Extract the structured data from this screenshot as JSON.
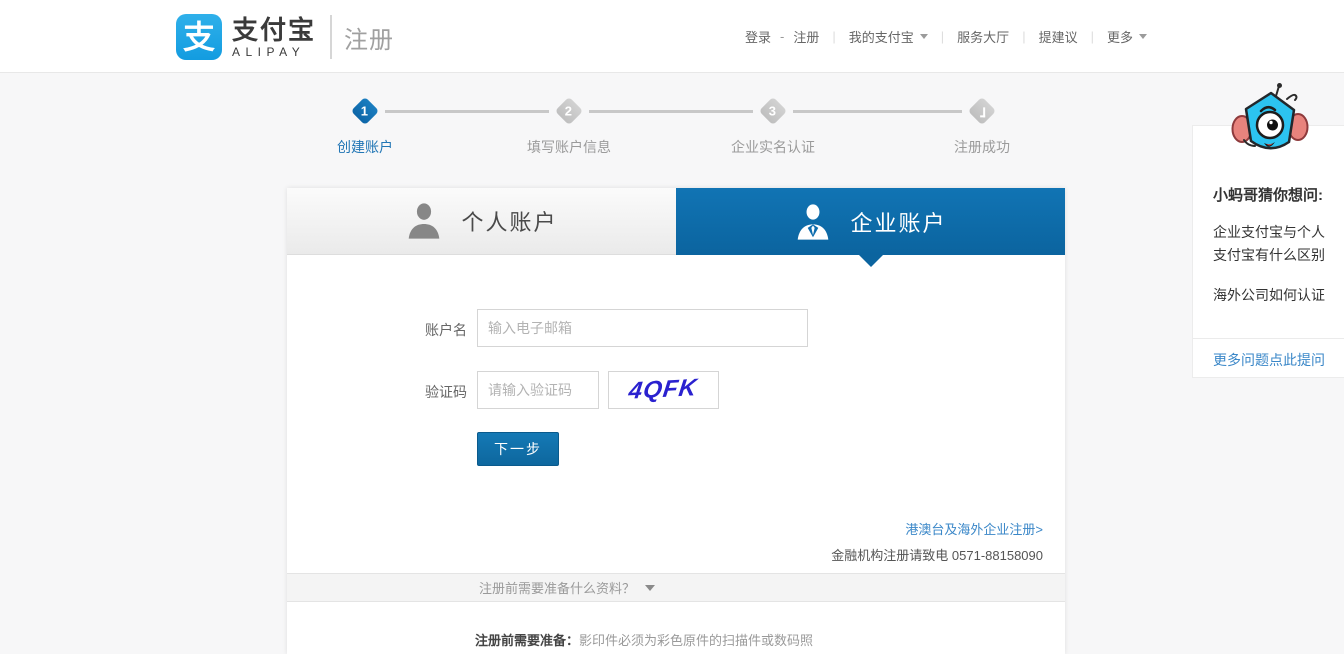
{
  "brand": {
    "logo_glyph": "支",
    "name_cn": "支付宝",
    "name_en": "ALIPAY",
    "page_label": "注册"
  },
  "nav": {
    "login": "登录",
    "register": "注册",
    "my_alipay": "我的支付宝",
    "service_hall": "服务大厅",
    "feedback": "提建议",
    "more": "更多",
    "sep_dash": "-",
    "sep_bar": "|"
  },
  "steps": {
    "items": [
      {
        "number": "1",
        "label": "创建账户",
        "state": "active"
      },
      {
        "number": "2",
        "label": "填写账户信息",
        "state": "pending"
      },
      {
        "number": "3",
        "label": "企业实名认证",
        "state": "pending"
      },
      {
        "number": "",
        "label": "注册成功",
        "state": "pending-check"
      }
    ]
  },
  "tabs": {
    "personal": "个人账户",
    "enterprise": "企业账户",
    "active_tab": "企业账户"
  },
  "form": {
    "account_label": "账户名",
    "account_placeholder": "输入电子邮箱",
    "account_value": "",
    "captcha_label": "验证码",
    "captcha_placeholder": "请输入验证码",
    "captcha_input_value": "",
    "captcha_value": "4QFK",
    "submit_label": "下一步"
  },
  "links": {
    "overseas": "港澳台及海外企业注册>",
    "finance": "金融机构注册请致电 0571-88158090"
  },
  "prepare": {
    "toggle_label": "注册前需要准备什么资料？",
    "note_prefix": "注册前需要准备：",
    "note_text": "影印件必须为彩色原件的扫描件或数码照"
  },
  "assistant": {
    "title": "小蚂哥猜你想问:",
    "questions": [
      "企业支付宝与个人支付宝有什么区别",
      "海外公司如何认证"
    ],
    "more_link": "更多问题点此提问"
  },
  "colors": {
    "accent_blue": "#0d6cae",
    "tab_blue_top": "#1174b4",
    "tab_blue_bottom": "#0b649f",
    "link_blue": "#3a87c8",
    "captcha_blue": "#2a21cf",
    "step_gray": "#c8c8c8"
  }
}
